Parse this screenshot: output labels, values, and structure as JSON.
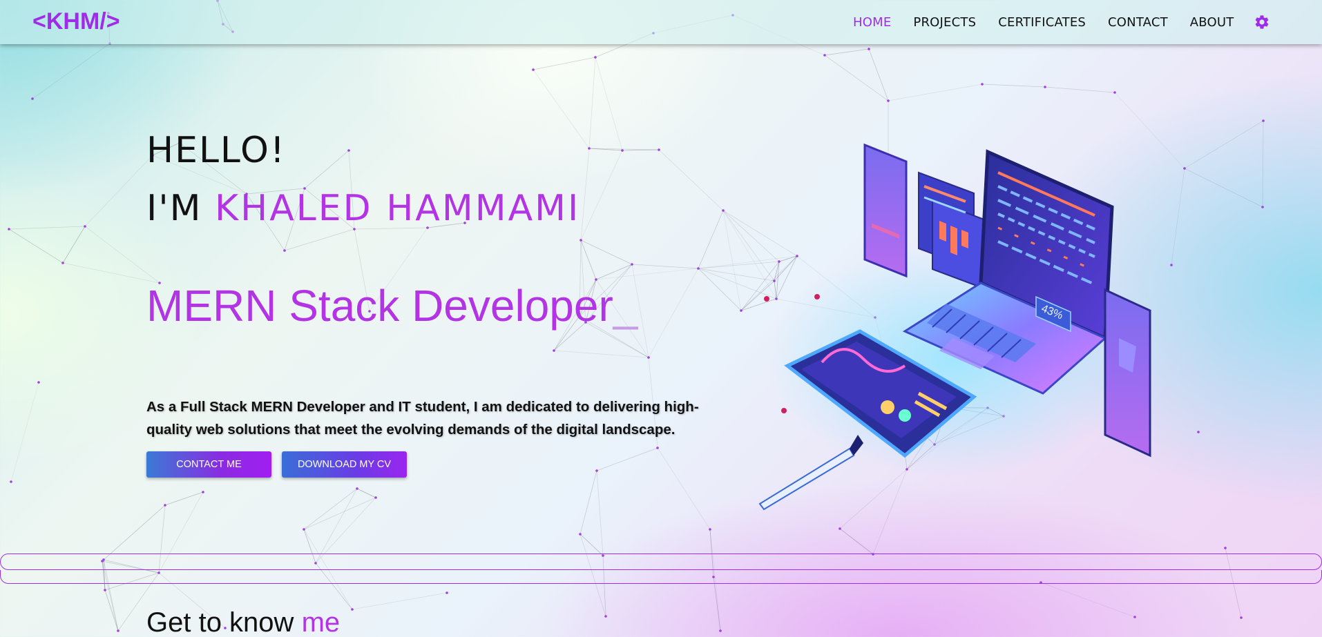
{
  "nav": {
    "logo": "<KHM/>",
    "links": [
      {
        "label": "HOME",
        "active": true
      },
      {
        "label": "PROJECTS",
        "active": false
      },
      {
        "label": "CERTIFICATES",
        "active": false
      },
      {
        "label": "CONTACT",
        "active": false
      },
      {
        "label": "ABOUT",
        "active": false
      }
    ],
    "settings_icon": "gear-icon"
  },
  "hero": {
    "greeting": "HELLO!",
    "im_prefix": "I'M ",
    "name": "KHALED HAMMAMI",
    "role": "MERN Stack Developer",
    "role_cursor": "_",
    "description": "As a Full Stack MERN Developer and IT student, I am dedicated to delivering high-quality web solutions that meet the evolving demands of the digital landscape.",
    "contact_button": "CONTACT ME",
    "cv_button": "DOWNLOAD MY CV",
    "illustration_icon": "isometric-laptop-illustration",
    "illustration_stat": "43%"
  },
  "about": {
    "title_prefix": "Get to know ",
    "title_accent": "me"
  },
  "colors": {
    "accent": "#a12ce8",
    "accent_light": "#b234e4",
    "text": "#111111"
  }
}
